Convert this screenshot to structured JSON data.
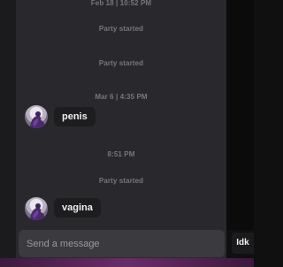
{
  "chat": {
    "events": [
      {
        "kind": "timestamp",
        "text": "Feb 18 | 10:52 PM"
      },
      {
        "kind": "system",
        "text": "Party started"
      },
      {
        "kind": "system",
        "text": "Party started"
      },
      {
        "kind": "timestamp",
        "text": "Mar 6 | 4:35 PM"
      },
      {
        "kind": "message",
        "text": "penis"
      },
      {
        "kind": "timestamp",
        "text": "8:51 PM"
      },
      {
        "kind": "system",
        "text": "Party started"
      },
      {
        "kind": "message",
        "text": "vagina"
      }
    ]
  },
  "composer": {
    "placeholder": "Send a message"
  },
  "side": {
    "button_label": "Idk"
  },
  "colors": {
    "panel": "#29292d",
    "bubble": "#1d1d20",
    "system_text": "#76767c",
    "composer": "#3a3a3f",
    "accent_bar": "#6b2c69"
  }
}
